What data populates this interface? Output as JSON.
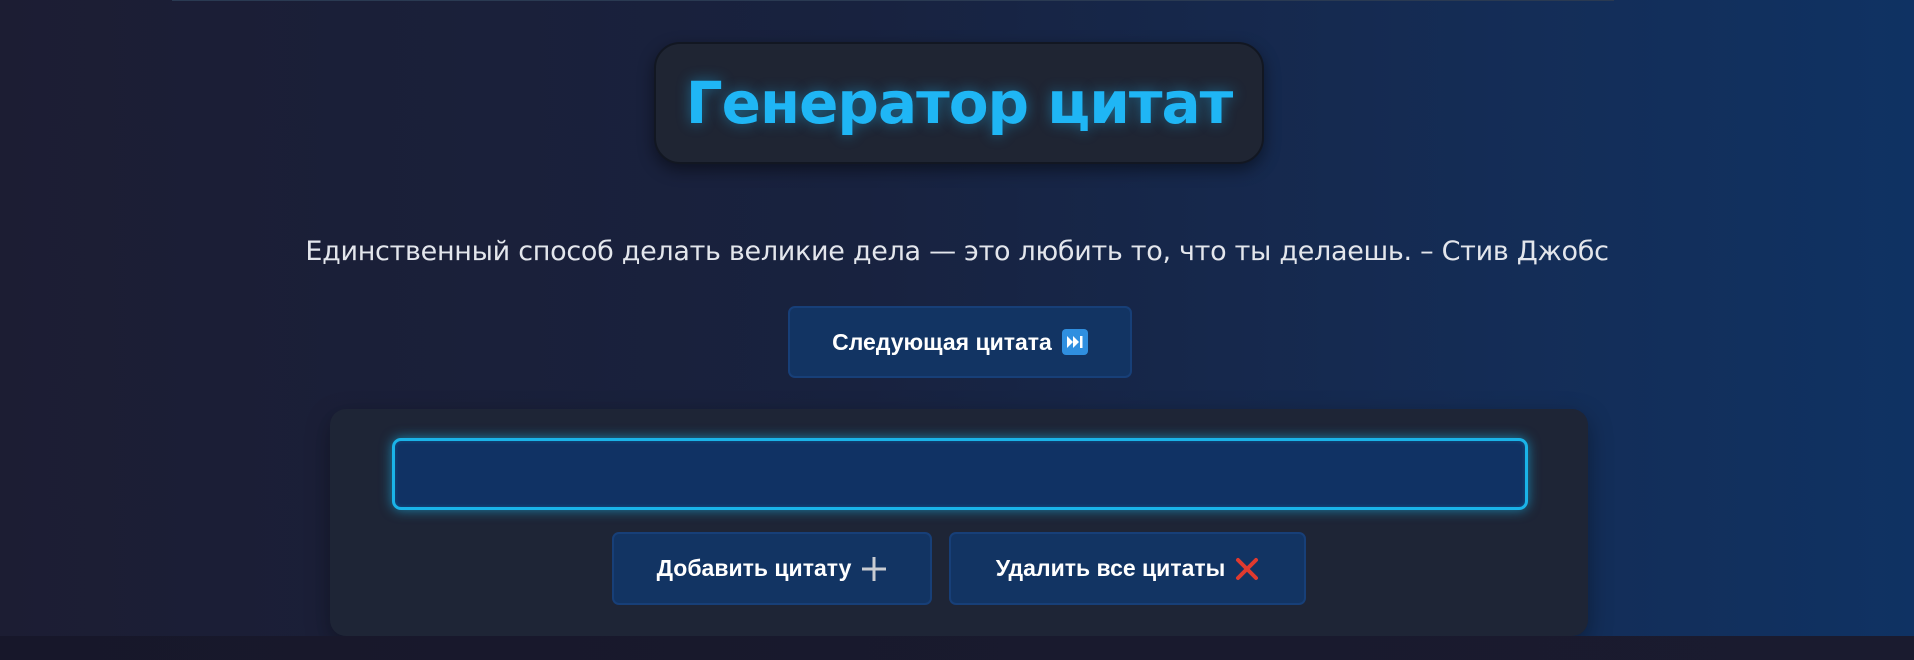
{
  "header": {
    "title": "Генератор цитат"
  },
  "quote": {
    "text": "Единственный способ делать великие дела — это любить то, что ты делаешь. – Стив Джобс"
  },
  "controls": {
    "next_label": "Следующая цитата",
    "next_icon": "next-track-icon",
    "add_label": "Добавить цитату",
    "add_icon": "plus-icon",
    "clear_label": "Удалить все цитаты",
    "clear_icon": "red-cross-icon"
  },
  "input": {
    "value": "",
    "placeholder": ""
  },
  "colors": {
    "title": "#1fb6f5",
    "button_bg": "#123463",
    "input_border": "#1ab3e8",
    "clear_icon": "#e03a2f"
  }
}
